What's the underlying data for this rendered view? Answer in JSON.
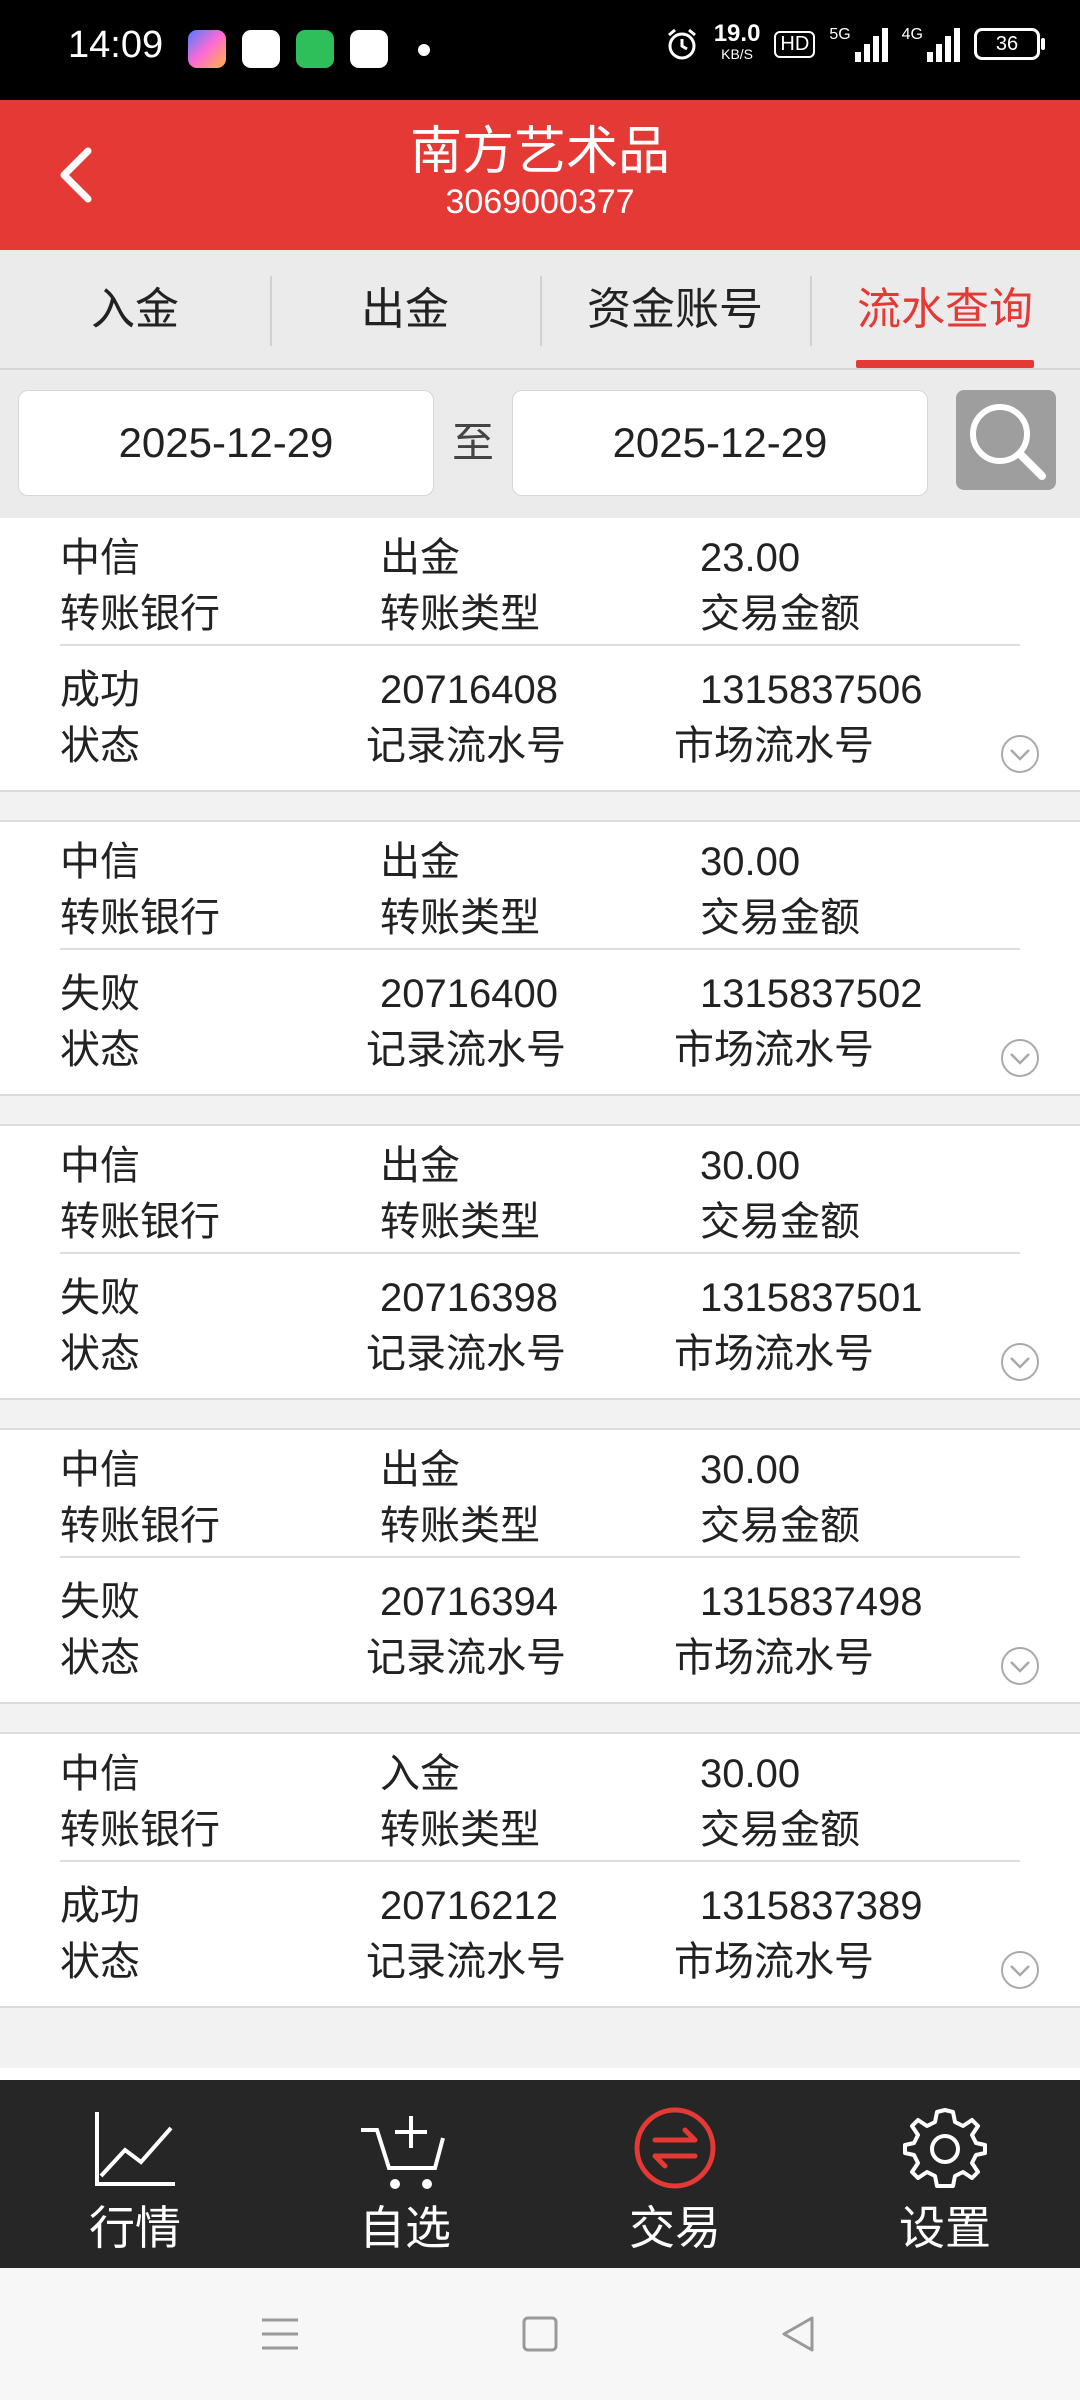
{
  "status_bar": {
    "time": "14:09",
    "net_speed_value": "19.0",
    "net_speed_unit": "KB/S",
    "hd_label": "HD",
    "signal_1": "5G",
    "signal_2": "4G",
    "battery": "36"
  },
  "header": {
    "title": "南方艺术品",
    "subtitle": "3069000377"
  },
  "tabs": [
    {
      "label": "入金"
    },
    {
      "label": "出金"
    },
    {
      "label": "资金账号"
    },
    {
      "label": "流水查询",
      "active": true
    }
  ],
  "search": {
    "start_date": "2025-12-29",
    "separator": "至",
    "end_date": "2025-12-29"
  },
  "field_labels": {
    "bank": "转账银行",
    "type": "转账类型",
    "amount": "交易金额",
    "status": "状态",
    "record_no": "记录流水号",
    "market_no": "市场流水号"
  },
  "records": [
    {
      "bank": "中信",
      "type": "出金",
      "amount": "23.00",
      "status": "成功",
      "record_no": "20716408",
      "market_no": "1315837506"
    },
    {
      "bank": "中信",
      "type": "出金",
      "amount": "30.00",
      "status": "失败",
      "record_no": "20716400",
      "market_no": "1315837502"
    },
    {
      "bank": "中信",
      "type": "出金",
      "amount": "30.00",
      "status": "失败",
      "record_no": "20716398",
      "market_no": "1315837501"
    },
    {
      "bank": "中信",
      "type": "出金",
      "amount": "30.00",
      "status": "失败",
      "record_no": "20716394",
      "market_no": "1315837498"
    },
    {
      "bank": "中信",
      "type": "入金",
      "amount": "30.00",
      "status": "成功",
      "record_no": "20716212",
      "market_no": "1315837389"
    }
  ],
  "bottom_nav": [
    {
      "label": "行情",
      "icon": "chart-line-icon"
    },
    {
      "label": "自选",
      "icon": "cart-plus-icon"
    },
    {
      "label": "交易",
      "icon": "exchange-icon",
      "active": true
    },
    {
      "label": "设置",
      "icon": "gear-icon"
    }
  ],
  "colors": {
    "accent": "#e53935",
    "nav_bg": "#262626",
    "tab_bg": "#ebebeb"
  }
}
